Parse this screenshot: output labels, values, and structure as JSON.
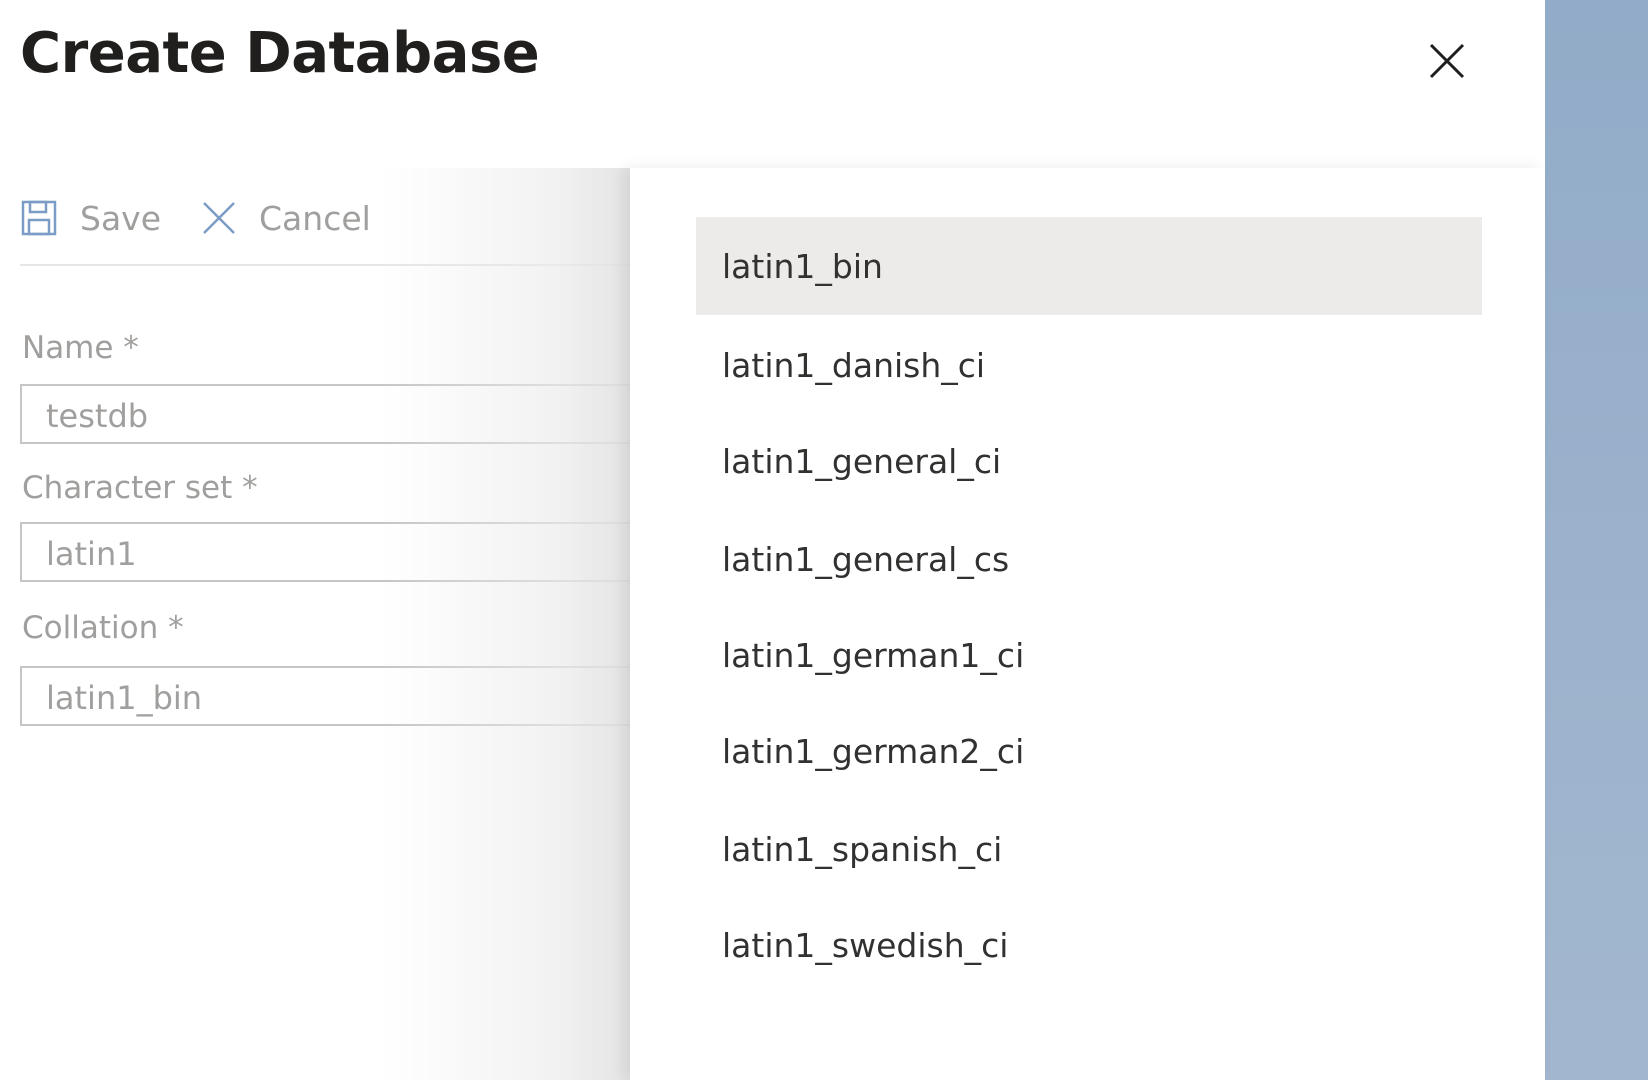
{
  "header": {
    "title": "Create Database"
  },
  "toolbar": {
    "save_label": "Save",
    "cancel_label": "Cancel"
  },
  "form": {
    "name_label": "Name *",
    "name_value": "testdb",
    "charset_label": "Character set *",
    "charset_value": "latin1",
    "collation_label": "Collation *",
    "collation_value": "latin1_bin"
  },
  "collation_options": [
    "latin1_bin",
    "latin1_danish_ci",
    "latin1_general_ci",
    "latin1_general_cs",
    "latin1_german1_ci",
    "latin1_german2_ci",
    "latin1_spanish_ci",
    "latin1_swedish_ci"
  ],
  "selected_option": "latin1_bin",
  "colors": {
    "selected_bg": "#edebe9",
    "backdrop": "#9db3cd",
    "muted_text": "#a19f9d",
    "toolbar_icon": "#7a9cc6"
  },
  "icons": {
    "save": "save-icon",
    "cancel": "cancel-icon",
    "close": "close-icon"
  }
}
